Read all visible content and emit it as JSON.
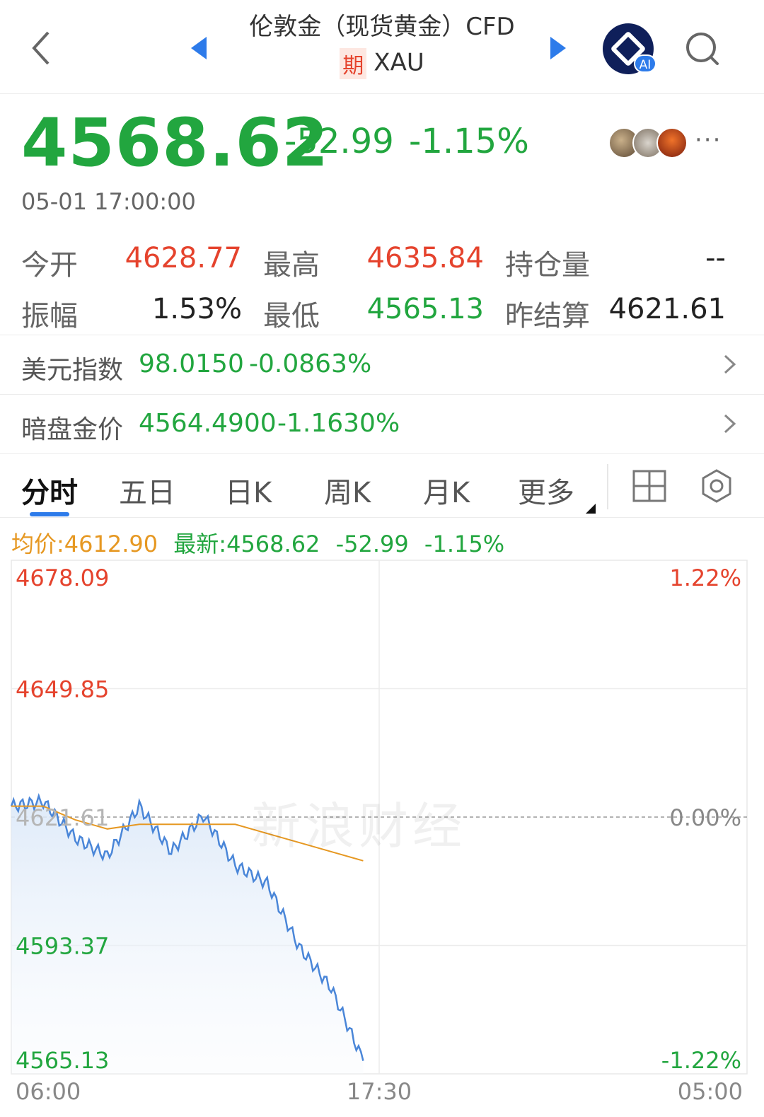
{
  "header": {
    "title": "伦敦金（现货黄金）CFD",
    "badge": "期",
    "symbol": "XAU",
    "ai_badge": "AI"
  },
  "quote": {
    "price": "4568.62",
    "change": "-52.99",
    "change_pct": "-1.15%",
    "timestamp": "05-01 17:00:00",
    "more": "···"
  },
  "stats": {
    "open_label": "今开",
    "open": "4628.77",
    "high_label": "最高",
    "high": "4635.84",
    "oi_label": "持仓量",
    "oi": "--",
    "amp_label": "振幅",
    "amp": "1.53%",
    "low_label": "最低",
    "low": "4565.13",
    "prev_label": "昨结算",
    "prev": "4621.61"
  },
  "related": [
    {
      "label": "美元指数",
      "value": "98.0150",
      "change": "-0.0863%"
    },
    {
      "label": "暗盘金价",
      "value": "4564.4900",
      "change": "-1.1630%"
    }
  ],
  "tabs": [
    "分时",
    "五日",
    "日K",
    "周K",
    "月K",
    "更多"
  ],
  "chart_info": {
    "avg": "均价:4612.90",
    "latest": "最新:4568.62",
    "change": "-52.99",
    "change_pct": "-1.15%"
  },
  "watermark": "新浪财经",
  "colors": {
    "up": "#e5432d",
    "down": "#22a63f",
    "accent": "#2d7bea",
    "avg_line": "#e69822",
    "price_line": "#4a86d8"
  },
  "chart_data": {
    "type": "line",
    "title": "",
    "xlabel": "",
    "ylabel": "",
    "x_ticks": [
      "06:00",
      "17:30",
      "05:00"
    ],
    "y_ticks_left": [
      "4678.09",
      "4649.85",
      "4621.61",
      "4593.37",
      "4565.13"
    ],
    "y_ticks_right": [
      "1.22%",
      "",
      "0.00%",
      "",
      "-1.22%"
    ],
    "ylim": [
      4565.13,
      4678.09
    ],
    "reference_value": 4621.61,
    "series": [
      {
        "name": "",
        "x": [
          "06:00",
          "07:00",
          "08:00",
          "09:00",
          "10:00",
          "11:00",
          "12:00",
          "13:00",
          "14:00",
          "15:00",
          "16:00",
          "17:00"
        ],
        "values": [
          4624,
          4625,
          4617,
          4613,
          4624,
          4614,
          4622,
          4611,
          4607,
          4593,
          4584,
          4568
        ]
      },
      {
        "name": "",
        "x": [
          "06:00",
          "07:00",
          "08:00",
          "09:00",
          "10:00",
          "11:00",
          "12:00",
          "13:00",
          "14:00",
          "15:00",
          "16:00",
          "17:00"
        ],
        "values": [
          4624,
          4624,
          4621,
          4619,
          4620,
          4620,
          4620,
          4620,
          4618,
          4616,
          4614,
          4612
        ]
      }
    ]
  }
}
